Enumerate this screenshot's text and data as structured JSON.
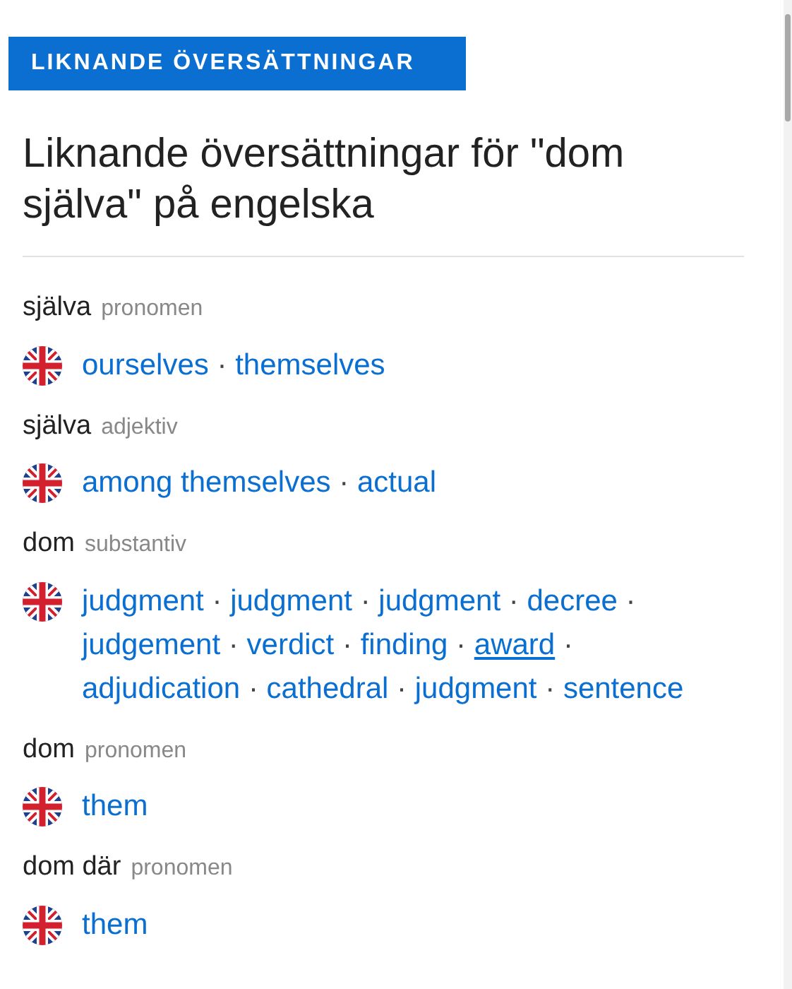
{
  "badge": "LIKNANDE ÖVERSÄTTNINGAR",
  "title": "Liknande översättningar för \"dom själva\" på engelska",
  "separator": "·",
  "entries": [
    {
      "word": "själva",
      "pos": "pronomen",
      "translations": [
        {
          "text": "ourselves",
          "underlined": false
        },
        {
          "text": "themselves",
          "underlined": false
        }
      ]
    },
    {
      "word": "själva",
      "pos": "adjektiv",
      "translations": [
        {
          "text": "among themselves",
          "underlined": false
        },
        {
          "text": "actual",
          "underlined": false
        }
      ]
    },
    {
      "word": "dom",
      "pos": "substantiv",
      "translations": [
        {
          "text": "judgment",
          "underlined": false
        },
        {
          "text": "judgment",
          "underlined": false
        },
        {
          "text": "judgment",
          "underlined": false
        },
        {
          "text": "decree",
          "underlined": false
        },
        {
          "text": "judgement",
          "underlined": false
        },
        {
          "text": "verdict",
          "underlined": false
        },
        {
          "text": "finding",
          "underlined": false
        },
        {
          "text": "award",
          "underlined": true
        },
        {
          "text": "adjudication",
          "underlined": false
        },
        {
          "text": "cathedral",
          "underlined": false
        },
        {
          "text": "judgment",
          "underlined": false
        },
        {
          "text": "sentence",
          "underlined": false
        }
      ]
    },
    {
      "word": "dom",
      "pos": "pronomen",
      "translations": [
        {
          "text": "them",
          "underlined": false
        }
      ]
    },
    {
      "word": "dom där",
      "pos": "pronomen",
      "translations": [
        {
          "text": "them",
          "underlined": false
        }
      ]
    }
  ]
}
